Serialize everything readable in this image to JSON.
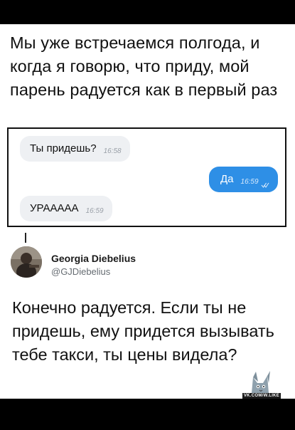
{
  "post": {
    "caption": "Мы уже встречаемся полгода, и когда я говорю, что приду, мой парень радуется как в первый раз"
  },
  "chat": {
    "messages": [
      {
        "direction": "incoming",
        "text": "Ты придешь?",
        "time": "16:58"
      },
      {
        "direction": "outgoing",
        "text": "Да",
        "time": "16:59",
        "read_icon": "double-check-icon"
      },
      {
        "direction": "incoming",
        "text": "УРАААAA",
        "time": "16:59"
      }
    ]
  },
  "tweet": {
    "name": "Georgia Diebelius",
    "handle": "@GJDiebelius",
    "text": "Конечно радуется. Если ты не придешь, ему придется вызывать тебе такси, ты цены видела?"
  },
  "watermark": {
    "label": "VK.COM/W.LIKE"
  },
  "colors": {
    "outgoing_bubble": "#2e8fe6",
    "incoming_bubble": "#eef0f3",
    "background": "#ffffff",
    "frame": "#000000"
  }
}
